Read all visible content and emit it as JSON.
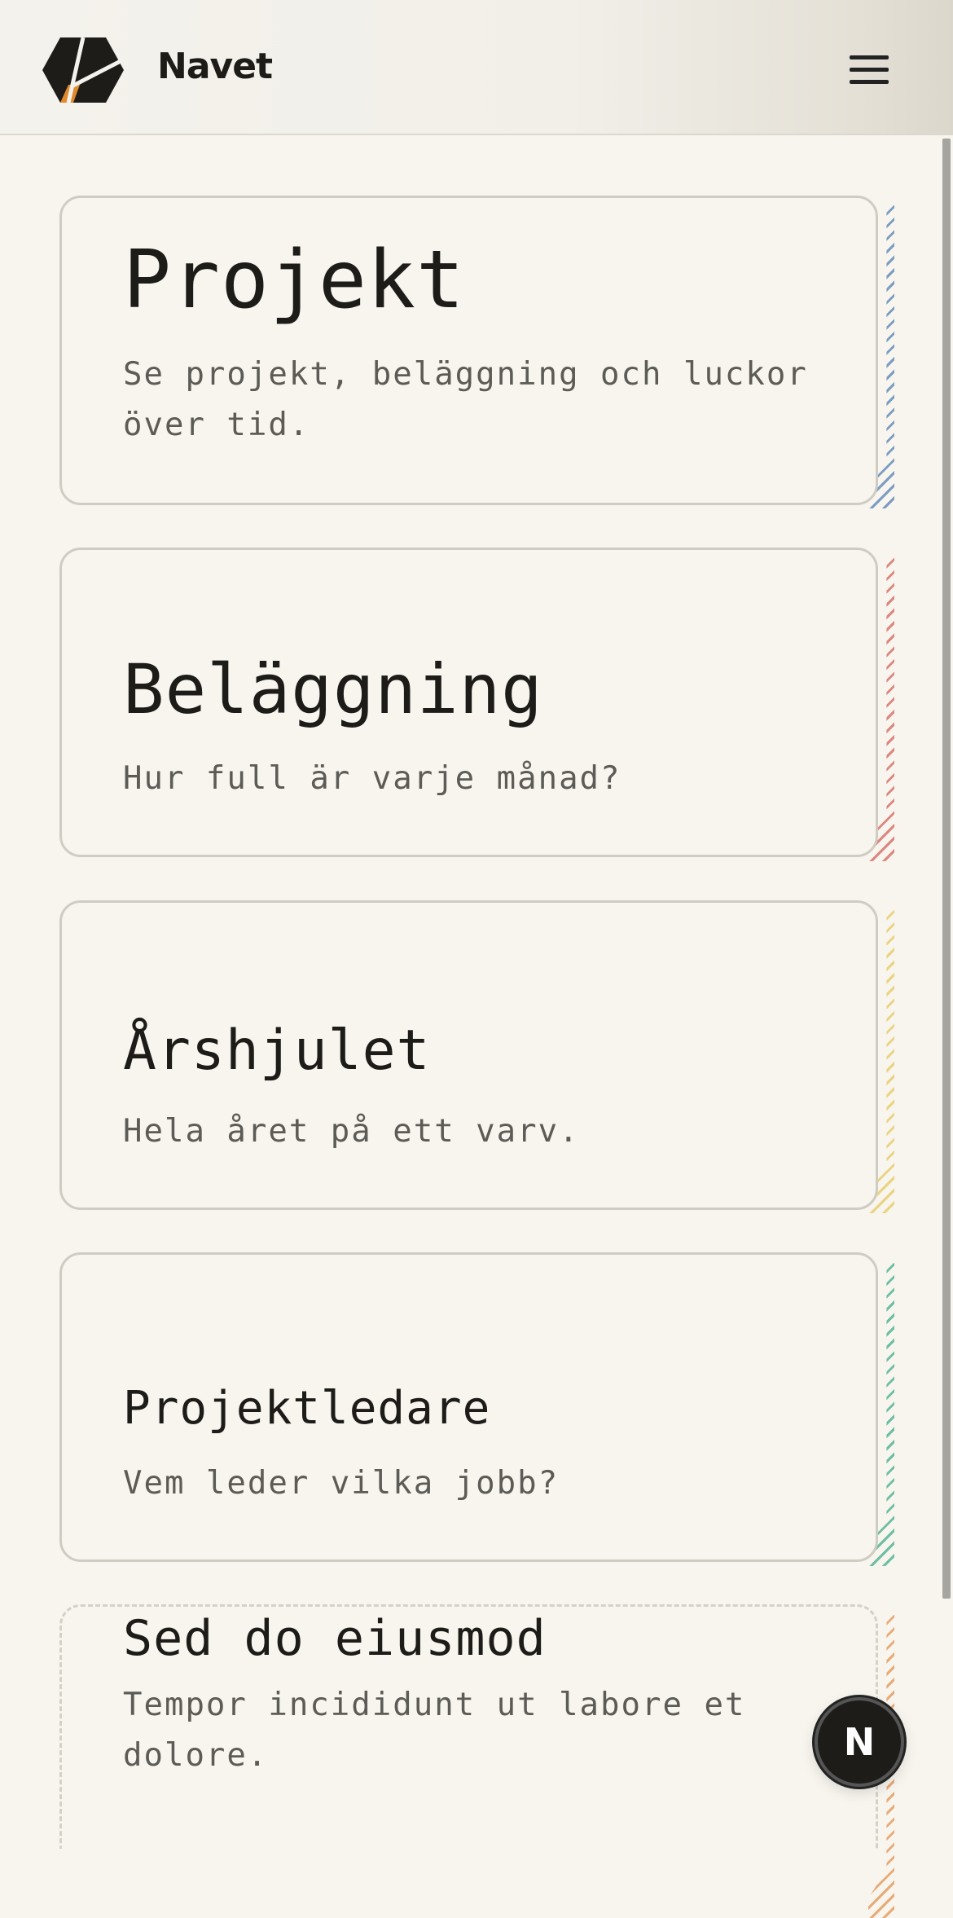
{
  "header": {
    "brand": "Navet",
    "menu_icon": "hamburger-icon",
    "logo_icon": "hexagon-logo-icon"
  },
  "cards": [
    {
      "title": "Projekt",
      "description": "Se projekt, beläggning och luckor över tid.",
      "accent": "#6f93bd"
    },
    {
      "title": "Beläggning",
      "description": "Hur full är varje månad?",
      "accent": "#d97b73"
    },
    {
      "title": "Årshjulet",
      "description": "Hela året på ett varv.",
      "accent": "#e9cf75"
    },
    {
      "title": "Projektledare",
      "description": "Vem leder vilka jobb?",
      "accent": "#5fb89b"
    },
    {
      "title": "Sed do eiusmod",
      "description": "Tempor incididunt ut labore et dolore.",
      "accent": "#e7a36a"
    }
  ],
  "fab": {
    "label": "N"
  },
  "colors": {
    "background": "#f7f5ee",
    "logo_dark": "#1d1c18",
    "logo_accent": "#e08a2c"
  }
}
